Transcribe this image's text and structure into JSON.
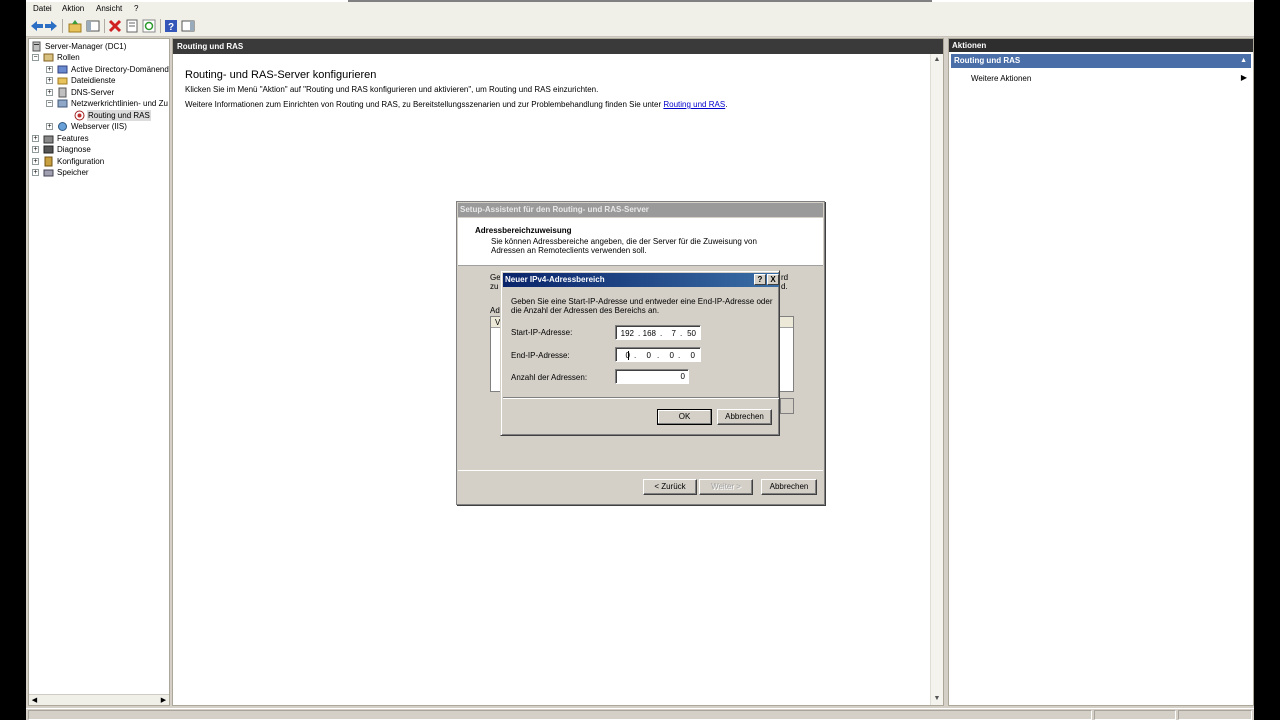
{
  "menubar": {
    "items": [
      "Datei",
      "Aktion",
      "Ansicht",
      "?"
    ]
  },
  "toolbar": {
    "icons": [
      "back-icon",
      "forward-icon",
      "up-folder-icon",
      "show-hide-tree-icon",
      "delete-icon",
      "properties-icon",
      "refresh-icon",
      "help-icon",
      "show-hide-action-pane-icon"
    ]
  },
  "tree": {
    "root": "Server-Manager (DC1)",
    "rollen": "Rollen",
    "ad": "Active Directory-Domänend",
    "datei": "Dateidienste",
    "dns": "DNS-Server",
    "netzwerk": "Netzwerkrichtlinien- und Zu",
    "routing": "Routing und RAS",
    "webserver": "Webserver (IIS)",
    "features": "Features",
    "diagnose": "Diagnose",
    "konfiguration": "Konfiguration",
    "speicher": "Speicher"
  },
  "center": {
    "header": "Routing und RAS",
    "title": "Routing- und RAS-Server konfigurieren",
    "p1": "Klicken Sie im Menü \"Aktion\" auf \"Routing und RAS konfigurieren und aktivieren\", um Routing und RAS einzurichten.",
    "p2_before": "Weitere Informationen zum Einrichten von Routing und RAS, zu Bereitstellungsszenarien und zur Problembehandlung finden Sie unter ",
    "p2_link": "Routing und RAS",
    "p2_after": "."
  },
  "actions": {
    "header": "Aktionen",
    "section": "Routing und RAS",
    "item": "Weitere Aktionen"
  },
  "wizard": {
    "title": "Setup-Assistent für den Routing- und RAS-Server",
    "heading": "Adressbereichzuweisung",
    "sub1": "Sie können Adressbereiche angeben, die der Server für die Zuweisung von",
    "sub2": "Adressen an Remoteclients verwenden soll.",
    "frag1": "Ge",
    "frag2": "zu",
    "frag3": "rd",
    "frag4": "d.",
    "frag5": "Ad",
    "frag6": "V",
    "back": "< Zurück",
    "next": "Weiter >",
    "cancel": "Abbrechen"
  },
  "ipdialog": {
    "title": "Neuer IPv4-Adressbereich",
    "help": "?",
    "close": "X",
    "desc1": "Geben Sie eine Start-IP-Adresse und entweder eine End-IP-Adresse oder",
    "desc2": "die Anzahl der Adressen des Bereichs an.",
    "start_label": "Start-IP-Adresse:",
    "start": [
      "192",
      "168",
      "7",
      "50"
    ],
    "end_label": "End-IP-Adresse:",
    "end": [
      "0",
      "0",
      "0",
      "0"
    ],
    "count_label": "Anzahl der Adressen:",
    "count": "0",
    "ok": "OK",
    "cancel": "Abbrechen"
  }
}
